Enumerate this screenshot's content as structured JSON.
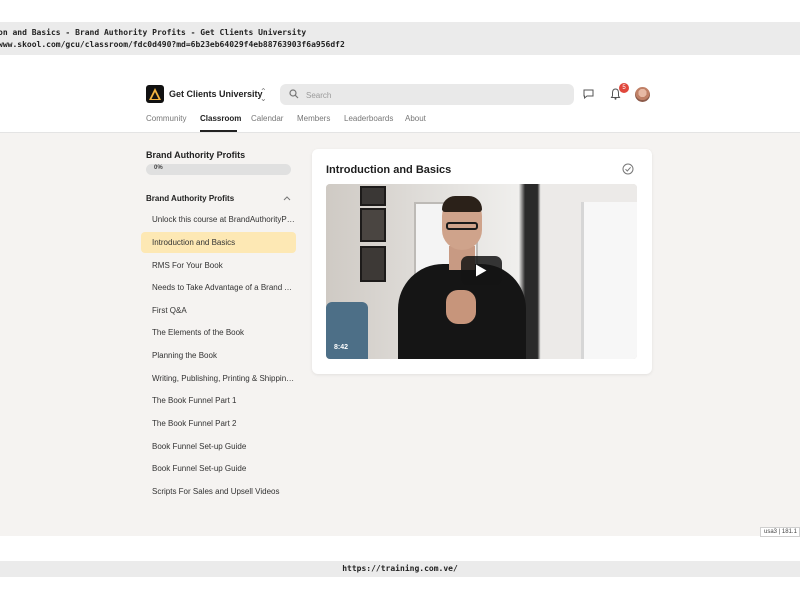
{
  "browser": {
    "title_line": "on and Basics - Brand Authority Profits - Get Clients University",
    "url_line": "www.skool.com/gcu/classroom/fdc0d490?md=6b23eb64029f4eb88763903f6a956df2"
  },
  "header": {
    "brand": "Get Clients University",
    "search_placeholder": "Search",
    "notification_count": "5",
    "nav": [
      "Community",
      "Classroom",
      "Calendar",
      "Members",
      "Leaderboards",
      "About"
    ],
    "active_tab": "Classroom"
  },
  "sidebar": {
    "course_title": "Brand Authority Profits",
    "progress_label": "0%",
    "progress": 0,
    "section_title": "Brand Authority Profits",
    "lessons": [
      "Unlock this course at BrandAuthorityPro...",
      "Introduction and Basics",
      "RMS For Your Book",
      "Needs to Take Advantage of a Brand Au...",
      "First Q&A",
      "The Elements of the Book",
      "Planning the Book",
      "Writing, Publishing, Printing & Shipping ...",
      "The Book Funnel Part 1",
      "The Book Funnel Part 2",
      "Book Funnel Set-up Guide",
      "Book Funnel Set-up Guide",
      "Scripts For Sales and Upsell Videos"
    ],
    "active_lesson_index": 1
  },
  "lesson": {
    "title": "Introduction and Basics",
    "video_duration": "8:42"
  },
  "version_tag": "usa3 | 181.1",
  "footer_url": "https://training.com.ve/",
  "colors": {
    "active_lesson_bg": "#fde8b4",
    "main_bg": "#f5f3f1",
    "badge": "#e0473c"
  }
}
